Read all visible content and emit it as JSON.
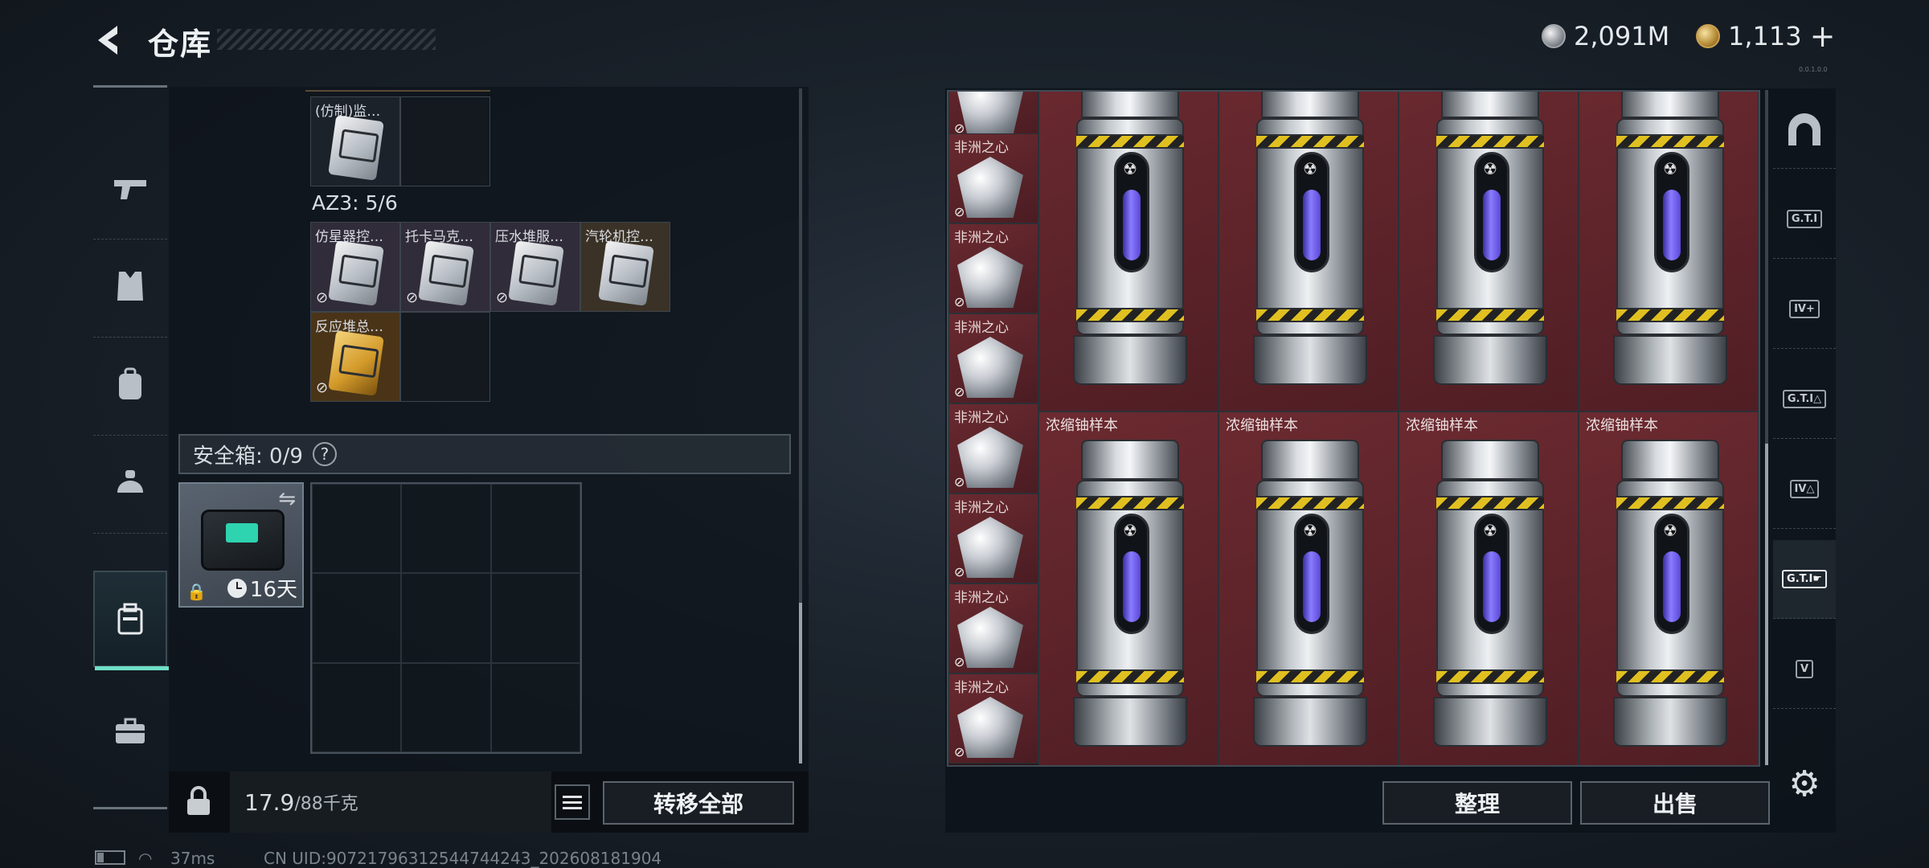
{
  "header": {
    "back_icon": "chevron-left-icon",
    "title": "仓库",
    "currency_silver": "2,091M",
    "currency_gold": "1,113",
    "add_label": "+",
    "version": "0.0.1.0.0"
  },
  "nav": {
    "items": [
      {
        "icon": "gun-icon",
        "glyph": "╾"
      },
      {
        "icon": "vest-icon",
        "glyph": "▦"
      },
      {
        "icon": "backpack-icon",
        "glyph": "▤"
      },
      {
        "icon": "helmet-icon",
        "glyph": "◓"
      },
      {
        "icon": "safe-case-icon",
        "glyph": "▣"
      },
      {
        "icon": "briefcase-icon",
        "glyph": "▬"
      }
    ]
  },
  "inventory": {
    "top_item_label": "(仿制)监…",
    "az3_label": "AZ3: 5/6",
    "az3_items": [
      "仿星器控…",
      "托卡马克…",
      "压水堆服…",
      "汽轮机控…",
      "反应堆总…"
    ],
    "no_trade_glyph": "⊘",
    "safe_box_label": "安全箱: 0/9",
    "help": "?",
    "safe_box_days": "16天",
    "swap_glyph": "⇋",
    "lock_glyph": "🔒",
    "weight_current": "17.9",
    "weight_max": "/88千克",
    "transfer_all": "转移全部"
  },
  "storage": {
    "diamond_label": "非洲之心",
    "uranium_label": "浓缩铀样本",
    "sort_button": "整理",
    "sell_button": "出售"
  },
  "side_tabs": [
    {
      "icon": "arch-icon",
      "glyph": "⌂",
      "gti": ""
    },
    {
      "icon": "gti-case-icon",
      "glyph": "",
      "gti": "G.T.I"
    },
    {
      "icon": "iv-add-icon",
      "glyph": "",
      "gti": "IV+"
    },
    {
      "icon": "gti-warning-icon",
      "glyph": "",
      "gti": "G.T.I△"
    },
    {
      "icon": "iv-warning-icon",
      "glyph": "",
      "gti": "IV△"
    },
    {
      "icon": "gti-hand-icon",
      "glyph": "",
      "gti": "G.T.I☛"
    },
    {
      "icon": "v-key-icon",
      "glyph": "",
      "gti": "V"
    }
  ],
  "settings_icon": "gear-icon",
  "status": {
    "ping": "37ms",
    "uid": "CN UID:9072179631254474424​3_202608181904"
  }
}
